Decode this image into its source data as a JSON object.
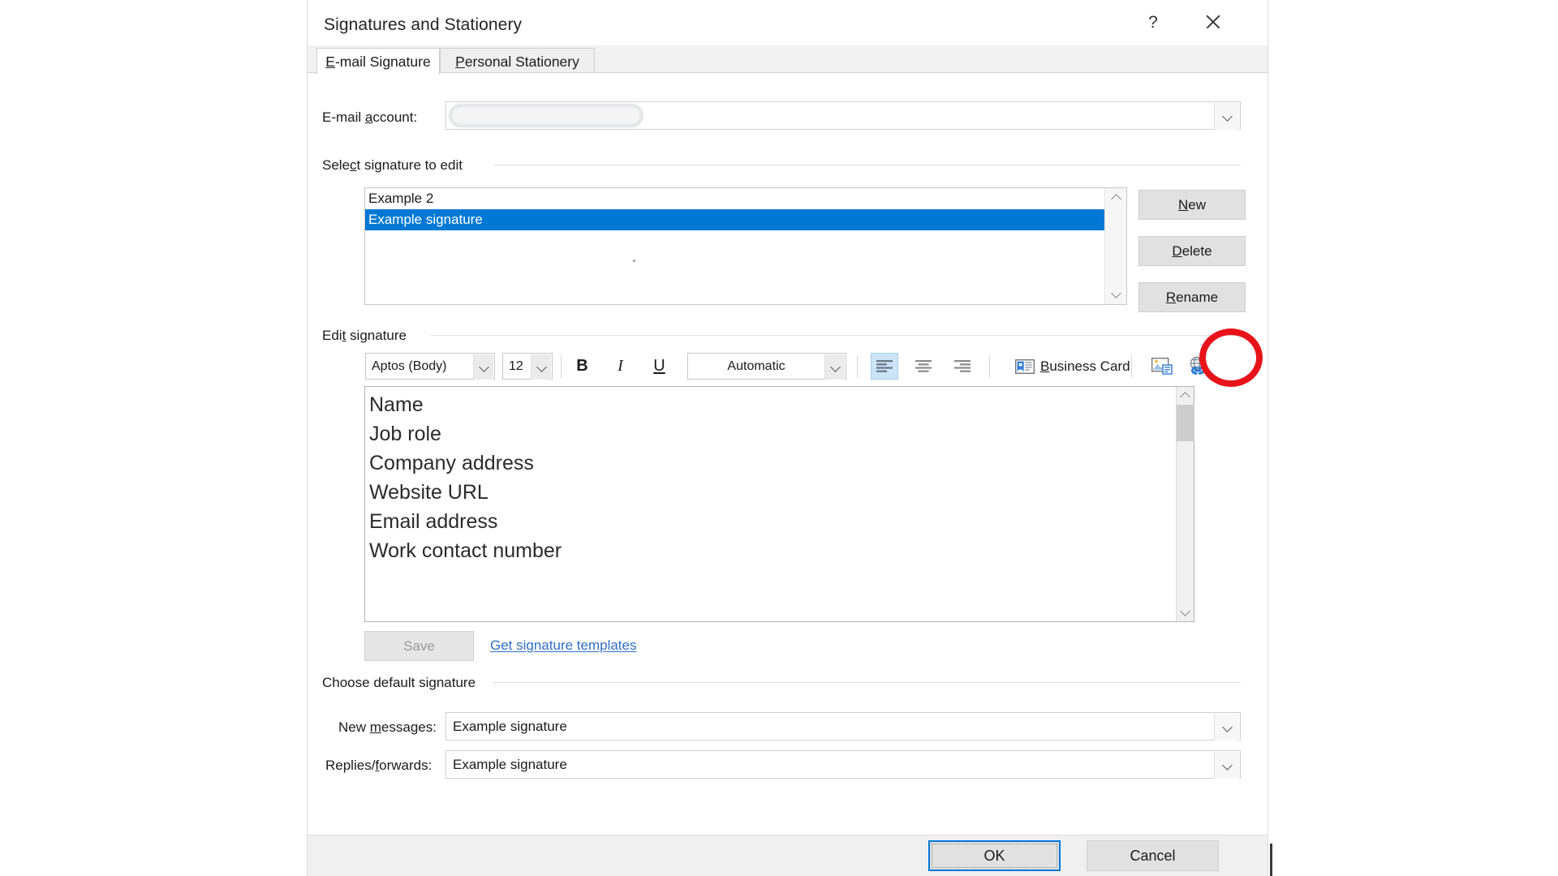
{
  "window": {
    "title": "Signatures and Stationery",
    "help_label": "?",
    "close_label": "×"
  },
  "tabs": [
    {
      "label": "E-mail Signature",
      "accel": "E",
      "active": true
    },
    {
      "label": "Personal Stationery",
      "accel": "P",
      "active": false
    }
  ],
  "account": {
    "label": "E-mail account:",
    "accel": "a",
    "value": "",
    "redacted": true
  },
  "select_signature": {
    "group_label": "Select signature to edit",
    "accel": "c",
    "items": [
      {
        "label": "Example 2",
        "selected": false
      },
      {
        "label": "Example signature",
        "selected": true
      }
    ],
    "buttons": [
      {
        "label": "New",
        "accel": "N"
      },
      {
        "label": "Delete",
        "accel": "D"
      },
      {
        "label": "Rename",
        "accel": "R"
      }
    ]
  },
  "edit_signature": {
    "group_label": "Edit signature",
    "accel": "t",
    "toolbar": {
      "font_family": "Aptos (Body)",
      "font_size": "12",
      "bold_label": "B",
      "italic_label": "I",
      "underline_label": "U",
      "font_color": "Automatic",
      "align_left": "align-left-icon",
      "align_center": "align-center-icon",
      "align_right": "align-right-icon",
      "business_card_label": "Business Card",
      "business_card_accel": "B",
      "picture_icon": "insert-picture-icon",
      "hyperlink_icon": "insert-hyperlink-icon",
      "active_alignment": "left"
    },
    "content_lines": [
      "Name",
      "Job role",
      "Company address",
      "Website URL",
      "Email address",
      "Work contact number"
    ],
    "content_text": "Name\nJob role\nCompany address\nWebsite URL\nEmail address\nWork contact number",
    "save_label": "Save",
    "save_enabled": false,
    "templates_link": "Get signature templates"
  },
  "default_signature": {
    "group_label": "Choose default signature",
    "new_messages_label": "New messages:",
    "new_messages_accel": "m",
    "new_messages_value": "Example signature",
    "replies_label": "Replies/forwards:",
    "replies_accel": "f",
    "replies_value": "Example signature"
  },
  "footer": {
    "ok_label": "OK",
    "cancel_label": "Cancel"
  },
  "annotation": {
    "shape": "ellipse",
    "color": "#e8131a",
    "target": "insert-hyperlink-button"
  },
  "colors": {
    "accent": "#0078d4",
    "selection": "#0078d4",
    "link": "#2f6fc4",
    "annotation": "#e8131a",
    "dialog_bg": "#f0f0f0",
    "panel_bg": "#ffffff"
  }
}
